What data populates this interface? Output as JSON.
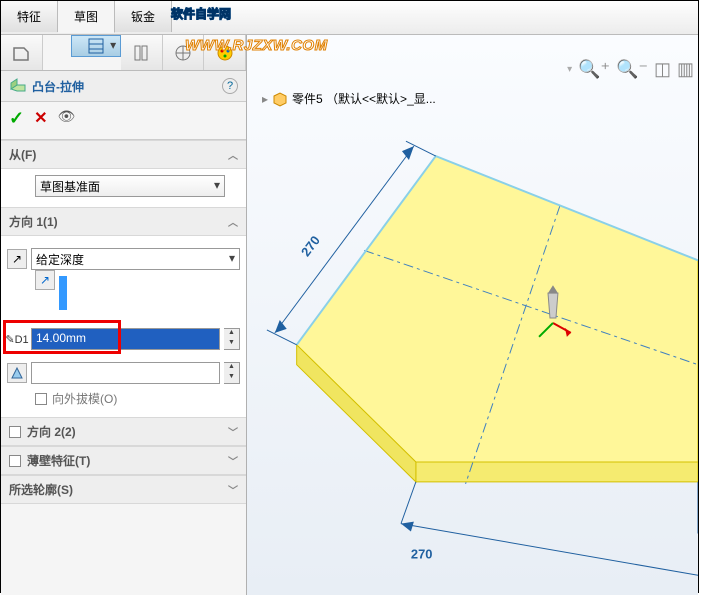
{
  "tabs": {
    "t1": "特征",
    "t2": "草图",
    "t3": "钣金"
  },
  "watermark": {
    "l1": "软件自学网",
    "l2": "WWW.RJZXW.COM"
  },
  "feature": {
    "name": "凸台-拉伸"
  },
  "from": {
    "header": "从(F)",
    "plane": "草图基准面"
  },
  "dir1": {
    "header": "方向 1(1)",
    "cond": "给定深度",
    "depth": "14.00mm",
    "draft_cb": "向外拔模(O)"
  },
  "dir2": {
    "header": "方向 2(2)"
  },
  "thin": {
    "header": "薄壁特征(T)"
  },
  "contour": {
    "header": "所选轮廓(S)"
  },
  "part": {
    "name": "零件5 （默认<<默认>_显..."
  },
  "dims": {
    "w": "270",
    "d": "270"
  },
  "chart_data": null
}
